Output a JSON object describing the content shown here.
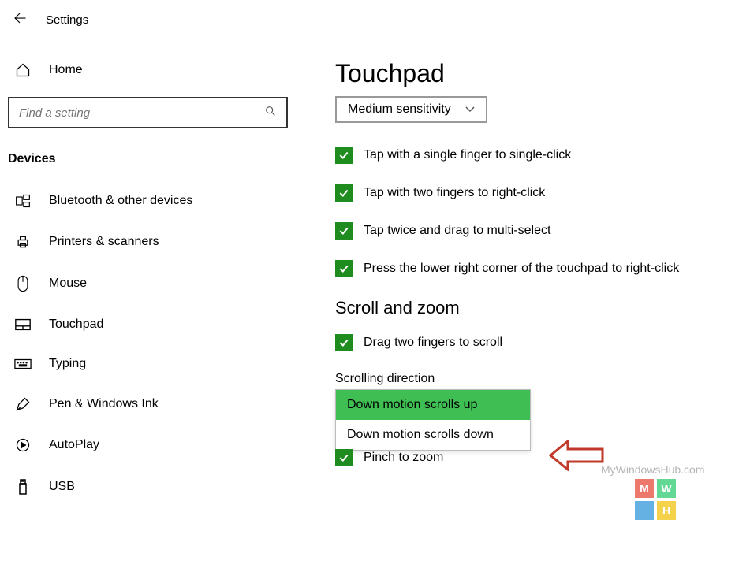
{
  "header": {
    "title": "Settings"
  },
  "sidebar": {
    "home_label": "Home",
    "search_placeholder": "Find a setting",
    "section_label": "Devices",
    "items": [
      {
        "label": "Bluetooth & other devices"
      },
      {
        "label": "Printers & scanners"
      },
      {
        "label": "Mouse"
      },
      {
        "label": "Touchpad"
      },
      {
        "label": "Typing"
      },
      {
        "label": "Pen & Windows Ink"
      },
      {
        "label": "AutoPlay"
      },
      {
        "label": "USB"
      }
    ]
  },
  "main": {
    "title": "Touchpad",
    "sensitivity_selected": "Medium sensitivity",
    "checks": [
      {
        "label": "Tap with a single finger to single-click"
      },
      {
        "label": "Tap with two fingers to right-click"
      },
      {
        "label": "Tap twice and drag to multi-select"
      },
      {
        "label": "Press the lower right corner of the touchpad to right-click"
      }
    ],
    "scroll_heading": "Scroll and zoom",
    "scroll_check_label": "Drag two fingers to scroll",
    "scroll_dir_label": "Scrolling direction",
    "scroll_dir_options": [
      "Down motion scrolls up",
      "Down motion scrolls down"
    ],
    "pinch_label": "Pinch to zoom"
  },
  "watermark": {
    "text": "MyWindowsHub.com",
    "logo_letters": [
      "M",
      "W",
      "H"
    ]
  }
}
